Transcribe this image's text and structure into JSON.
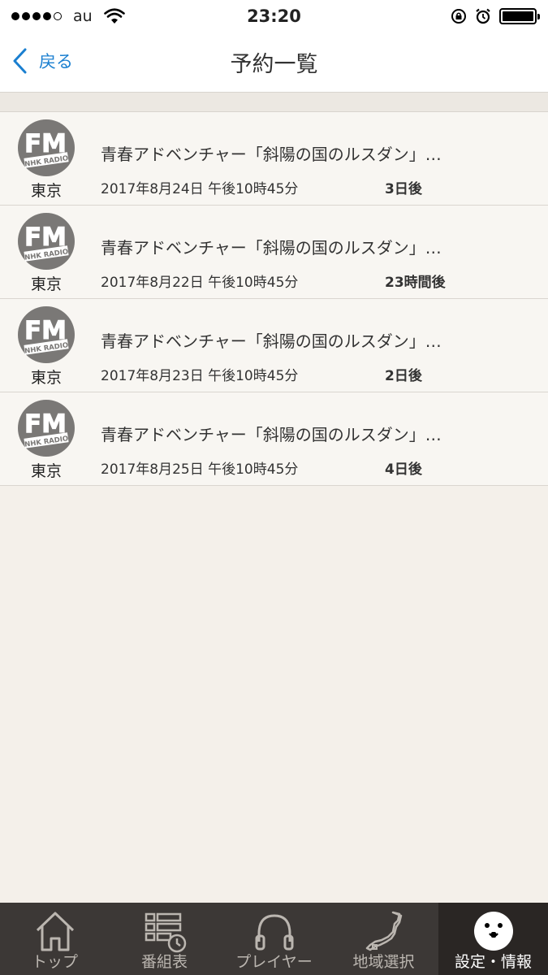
{
  "status_bar": {
    "carrier": "au",
    "time": "23:20"
  },
  "nav": {
    "back_label": "戻る",
    "title": "予約一覧"
  },
  "reservations": [
    {
      "station": "東京",
      "title": "青春アドベンチャー「斜陽の国のルスダン」…",
      "date": "2017年8月24日 午後10時45分",
      "remaining": "3日後"
    },
    {
      "station": "東京",
      "title": "青春アドベンチャー「斜陽の国のルスダン」…",
      "date": "2017年8月22日 午後10時45分",
      "remaining": "23時間後"
    },
    {
      "station": "東京",
      "title": "青春アドベンチャー「斜陽の国のルスダン」…",
      "date": "2017年8月23日 午後10時45分",
      "remaining": "2日後"
    },
    {
      "station": "東京",
      "title": "青春アドベンチャー「斜陽の国のルスダン」…",
      "date": "2017年8月25日 午後10時45分",
      "remaining": "4日後"
    }
  ],
  "tabs": [
    {
      "label": "トップ",
      "icon": "home-icon",
      "active": false
    },
    {
      "label": "番組表",
      "icon": "schedule-icon",
      "active": false
    },
    {
      "label": "プレイヤー",
      "icon": "headphones-icon",
      "active": false
    },
    {
      "label": "地域選択",
      "icon": "japan-map-icon",
      "active": false
    },
    {
      "label": "設定・情報",
      "icon": "mascot-icon",
      "active": true
    }
  ],
  "colors": {
    "accent": "#1a7fd0",
    "tab_bar": "#3c3836",
    "tab_active": "#2a2624",
    "background": "#f4f0ea",
    "row": "#f8f6f2"
  }
}
